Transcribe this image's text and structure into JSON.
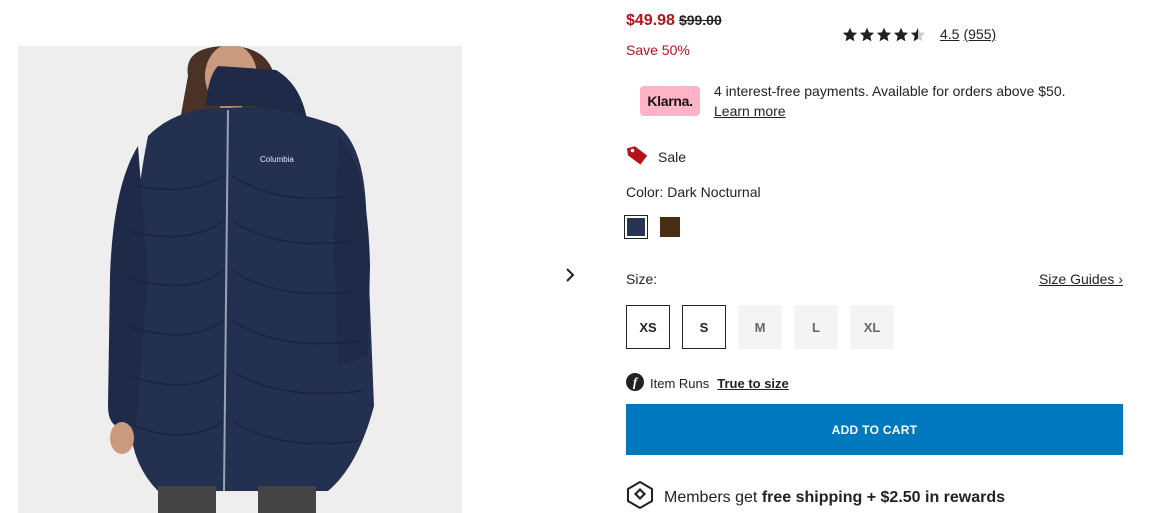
{
  "product": {
    "sale_price": "$49.98",
    "original_price": "$99.00",
    "savings": "Save 50%"
  },
  "rating": {
    "value": "4.5",
    "count": "(955)",
    "stars": 4.5
  },
  "klarna": {
    "badge": "Klarna.",
    "message": "4 interest-free payments. Available for orders above $50.",
    "learn_more": "Learn more"
  },
  "sale_badge": "Sale",
  "color": {
    "label": "Color: Dark Nocturnal",
    "swatches": [
      {
        "name": "Dark Nocturnal",
        "hex": "#283454",
        "selected": true
      },
      {
        "name": "Brown",
        "hex": "#4a2e14",
        "selected": false
      }
    ]
  },
  "size": {
    "label": "Size:",
    "guides_link": "Size Guides ›",
    "options": [
      {
        "label": "XS",
        "available": true
      },
      {
        "label": "S",
        "available": true
      },
      {
        "label": "M",
        "available": false
      },
      {
        "label": "L",
        "available": false
      },
      {
        "label": "XL",
        "available": false
      }
    ]
  },
  "fit": {
    "prefix": "Item Runs",
    "link": "True to size"
  },
  "cart": {
    "button_label": "ADD TO CART"
  },
  "members": {
    "prefix": "Members get",
    "bold": "free shipping + $2.50 in rewards"
  },
  "colors": {
    "sale_red": "#b5121b",
    "cart_blue": "#0078bd",
    "klarna_pink": "#ffb3c7"
  },
  "icons": {
    "carousel_next": "chevron-right-icon",
    "sale": "price-tag-icon",
    "fit": "fit-predictor-icon",
    "members": "members-rewards-icon",
    "rating": "star-icon"
  }
}
